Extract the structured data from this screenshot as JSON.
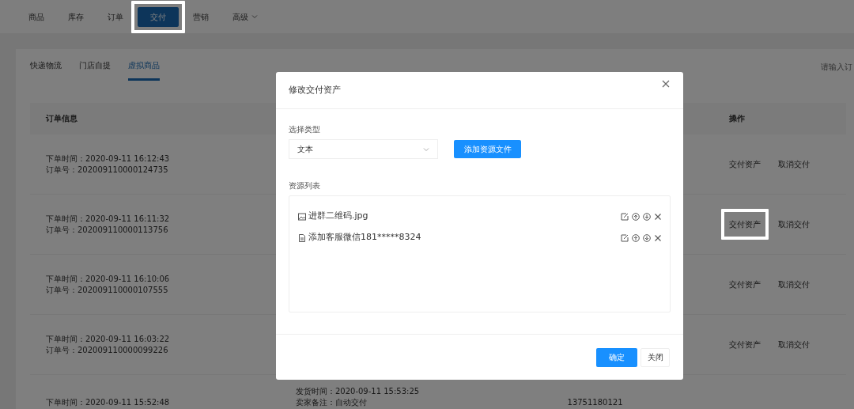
{
  "nav": [
    {
      "label": "商品",
      "kind": "link",
      "selected": false,
      "highlighted": false
    },
    {
      "label": "库存",
      "kind": "link",
      "selected": false,
      "highlighted": false
    },
    {
      "label": "订单",
      "kind": "link",
      "selected": false,
      "highlighted": false
    },
    {
      "label": "交付",
      "kind": "link",
      "selected": true,
      "highlighted": true
    },
    {
      "label": "营销",
      "kind": "link",
      "selected": false,
      "highlighted": false
    },
    {
      "label": "高级",
      "kind": "dropdown",
      "selected": false,
      "highlighted": false
    }
  ],
  "subtabs": [
    {
      "label": "快递物流",
      "selected": false
    },
    {
      "label": "门店自提",
      "selected": false
    },
    {
      "label": "虚拟商品",
      "selected": true
    }
  ],
  "search": {
    "placeholder": "请输入订"
  },
  "table": {
    "columns": [
      {
        "label": "订单信息"
      },
      {
        "label": "操作"
      }
    ],
    "rows": [
      {
        "order_time": "下单时间：2020-09-11 16:12:43",
        "order_no": "订单号：202009110000124735",
        "actions": [
          {
            "label": "交付资产",
            "highlighted": false
          },
          {
            "label": "取消交付",
            "highlighted": false
          }
        ]
      },
      {
        "order_time": "下单时间：2020-09-11 16:11:32",
        "order_no": "订单号：202009110000113756",
        "actions": [
          {
            "label": "交付资产",
            "highlighted": true
          },
          {
            "label": "取消交付",
            "highlighted": false
          }
        ]
      },
      {
        "order_time": "下单时间：2020-09-11 16:10:06",
        "order_no": "订单号：202009110000107555",
        "actions": [
          {
            "label": "交付资产",
            "highlighted": false
          },
          {
            "label": "取消交付",
            "highlighted": false
          }
        ]
      },
      {
        "order_time": "下单时间：2020-09-11 16:03:22",
        "order_no": "订单号：202009110000099226",
        "actions": [
          {
            "label": "交付资产",
            "highlighted": false
          },
          {
            "label": "取消交付",
            "highlighted": false
          }
        ]
      },
      {
        "order_time": "下单时间：2020-09-11 15:52:48",
        "ship_time": "发货时间：2020-09-11 15:53:25",
        "seller_note": "卖家备注：自动交付",
        "phone": "13751180121"
      }
    ]
  },
  "modal": {
    "title": "修改交付资产",
    "type_label": "选择类型",
    "type_select": {
      "value": "文本"
    },
    "add_button": "添加资源文件",
    "list_label": "资源列表",
    "resources": [
      {
        "kind": "image",
        "name": "进群二维码.jpg"
      },
      {
        "kind": "text",
        "name": "添加客服微信181*****8324"
      }
    ],
    "buttons": [
      {
        "label": "确定",
        "kind": "primary"
      },
      {
        "label": "关闭",
        "kind": "secondary"
      }
    ]
  }
}
